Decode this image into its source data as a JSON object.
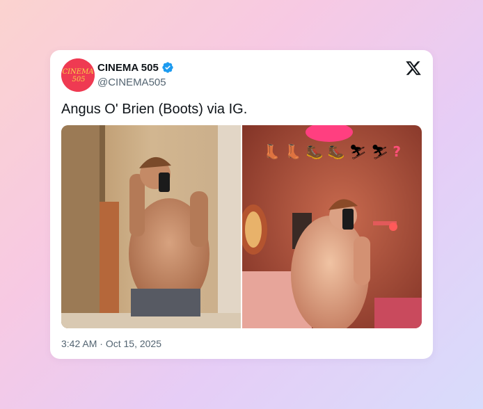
{
  "tweet": {
    "author": {
      "display_name": "CINEMA 505",
      "handle": "@CINEMA505",
      "verified": true,
      "avatar_text": "CINEMA 505",
      "avatar_color": "#ef3a52"
    },
    "platform_icon": "x-logo-icon",
    "text": "Angus O' Brien (Boots) via IG.",
    "media": [
      {
        "id": "photo-left",
        "description_icon": "mirror-selfie-photo"
      },
      {
        "id": "photo-right",
        "description_icon": "mirror-selfie-photo",
        "overlay_emoji": [
          "👢",
          "👢",
          "🥾",
          "🥾",
          "⛷",
          "⛷",
          "?"
        ]
      }
    ],
    "time": "3:42 AM",
    "separator": "·",
    "date": "Oct 15, 2025"
  },
  "colors": {
    "verified_badge": "#1d9bf0",
    "text_primary": "#0f1419",
    "text_secondary": "#536471"
  }
}
